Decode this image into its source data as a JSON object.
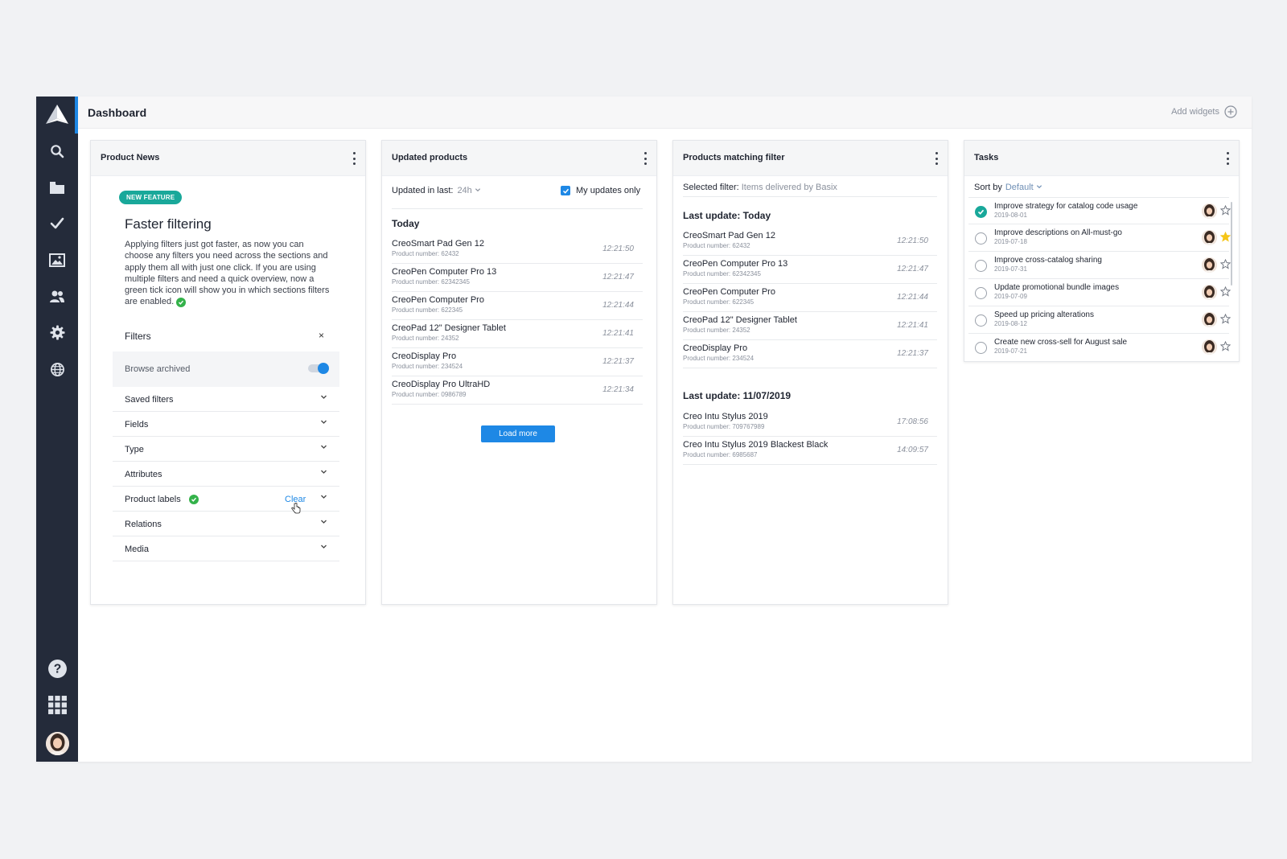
{
  "app": {
    "title": "Dashboard",
    "add_widgets_label": "Add widgets"
  },
  "sidebar": {
    "items": [
      {
        "icon": "search-icon"
      },
      {
        "icon": "folder-icon"
      },
      {
        "icon": "checkmark-icon"
      },
      {
        "icon": "image-icon"
      },
      {
        "icon": "users-icon"
      },
      {
        "icon": "gear-icon"
      },
      {
        "icon": "globe-icon"
      }
    ],
    "bottom": [
      {
        "icon": "help-icon"
      },
      {
        "icon": "apps-grid-icon"
      },
      {
        "icon": "user-avatar"
      }
    ]
  },
  "colors": {
    "sidebar_bg": "#242b3a",
    "accent_blue": "#1e88e5",
    "badge_teal": "#19a89a",
    "check_green": "#34b24a",
    "star_yellow": "#f5c518"
  },
  "product_news": {
    "title": "Product News",
    "badge": "NEW FEATURE",
    "heading": "Faster filtering",
    "body": "Applying filters just got faster, as now you can choose any filters you need across the sections and apply them all with just one click. If you are using multiple filters and need a quick overview, now a green tick icon will show you in which sections filters are enabled.",
    "filters_title": "Filters",
    "close_symbol": "×",
    "browse_archived": "Browse archived",
    "browse_archived_on": true,
    "filter_items": [
      {
        "label": "Saved filters"
      },
      {
        "label": "Fields"
      },
      {
        "label": "Type"
      },
      {
        "label": "Attributes"
      },
      {
        "label": "Product labels",
        "active": true,
        "action": "Clear"
      },
      {
        "label": "Relations"
      },
      {
        "label": "Media"
      }
    ]
  },
  "updated_products": {
    "title": "Updated products",
    "updated_in_last_label": "Updated in last:",
    "updated_in_last_value": "24h",
    "my_updates_only_label": "My updates only",
    "my_updates_only_checked": true,
    "section": "Today",
    "rows": [
      {
        "name": "CreoSmart Pad Gen 12",
        "number": "Product number: 62432",
        "time": "12:21:50"
      },
      {
        "name": "CreoPen Computer Pro 13",
        "number": "Product number: 62342345",
        "time": "12:21:47"
      },
      {
        "name": "CreoPen Computer Pro",
        "number": "Product number: 622345",
        "time": "12:21:44"
      },
      {
        "name": "CreoPad 12\" Designer Tablet",
        "number": "Product number: 24352",
        "time": "12:21:41"
      },
      {
        "name": "CreoDisplay Pro",
        "number": "Product number: 234524",
        "time": "12:21:37"
      },
      {
        "name": "CreoDisplay Pro UltraHD",
        "number": "Product number: 0986789",
        "time": "12:21:34"
      }
    ],
    "load_more_label": "Load more"
  },
  "products_matching": {
    "title": "Products matching filter",
    "selected_filter_label": "Selected filter:",
    "selected_filter_value": "Items delivered by Basix",
    "sections": [
      {
        "heading": "Last update: Today",
        "rows": [
          {
            "name": "CreoSmart Pad Gen 12",
            "number": "Product number: 62432",
            "time": "12:21:50"
          },
          {
            "name": "CreoPen Computer Pro 13",
            "number": "Product number: 62342345",
            "time": "12:21:47"
          },
          {
            "name": "CreoPen Computer Pro",
            "number": "Product number: 622345",
            "time": "12:21:44"
          },
          {
            "name": "CreoPad 12\" Designer Tablet",
            "number": "Product number: 24352",
            "time": "12:21:41"
          },
          {
            "name": "CreoDisplay Pro",
            "number": "Product number: 234524",
            "time": "12:21:37"
          }
        ]
      },
      {
        "heading": "Last update: 11/07/2019",
        "rows": [
          {
            "name": "Creo Intu Stylus 2019",
            "number": "Product number: 709767989",
            "time": "17:08:56"
          },
          {
            "name": "Creo Intu Stylus 2019 Blackest Black",
            "number": "Product number: 6985687",
            "time": "14:09:57"
          }
        ]
      }
    ]
  },
  "tasks": {
    "title": "Tasks",
    "sort_by_label": "Sort by",
    "sort_by_value": "Default",
    "items": [
      {
        "title": "Improve strategy for catalog code usage",
        "date": "2019-08-01",
        "done": true,
        "starred": false
      },
      {
        "title": "Improve descriptions on All-must-go",
        "date": "2019-07-18",
        "done": false,
        "starred": true
      },
      {
        "title": "Improve cross-catalog sharing",
        "date": "2019-07-31",
        "done": false,
        "starred": false
      },
      {
        "title": "Update promotional bundle images",
        "date": "2019-07-09",
        "done": false,
        "starred": false
      },
      {
        "title": "Speed up pricing alterations",
        "date": "2019-08-12",
        "done": false,
        "starred": false
      },
      {
        "title": "Create new cross-sell for August sale",
        "date": "2019-07-21",
        "done": false,
        "starred": false
      }
    ]
  }
}
